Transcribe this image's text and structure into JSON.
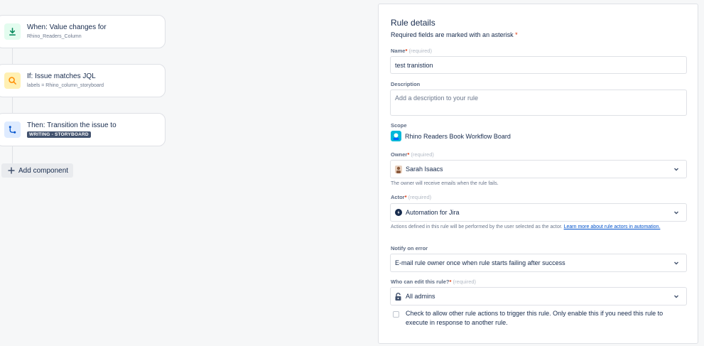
{
  "flow": {
    "trigger": {
      "title": "When: Value changes for",
      "subtitle": "Rhino_Readers_Column"
    },
    "condition": {
      "title": "If: Issue matches JQL",
      "subtitle": "labels = Rhino_column_storyboard"
    },
    "action": {
      "title": "Then: Transition the issue to",
      "status": "WRITING - STORYBOARD"
    },
    "add_component_label": "Add component"
  },
  "rule_details": {
    "title": "Rule details",
    "required_note": "Required fields are marked with an asterisk",
    "asterisk": "*",
    "required_hint": "(required)",
    "name": {
      "label": "Name",
      "value": "test tranistion"
    },
    "description": {
      "label": "Description",
      "placeholder": "Add a description to your rule"
    },
    "scope": {
      "label": "Scope",
      "value": "Rhino Readers Book Workflow Board"
    },
    "owner": {
      "label": "Owner",
      "value": "Sarah Isaacs",
      "help": "The owner will receive emails when the rule fails."
    },
    "actor": {
      "label": "Actor",
      "value": "Automation for Jira",
      "help": "Actions defined in this rule will be performed by the user selected as the actor.",
      "help_link": "Learn more about rule actors in automation."
    },
    "notify": {
      "label": "Notify on error",
      "value": "E-mail rule owner once when rule starts failing after success"
    },
    "who_can_edit": {
      "label": "Who can edit this rule?",
      "value": "All admins"
    },
    "allow_trigger": {
      "label": "Check to allow other rule actions to trigger this rule. Only enable this if you need this rule to execute in response to another rule.",
      "checked": false
    }
  },
  "colors": {
    "asterisk": "#de350b",
    "link": "#0052cc",
    "status_lozenge": "#42526e"
  }
}
